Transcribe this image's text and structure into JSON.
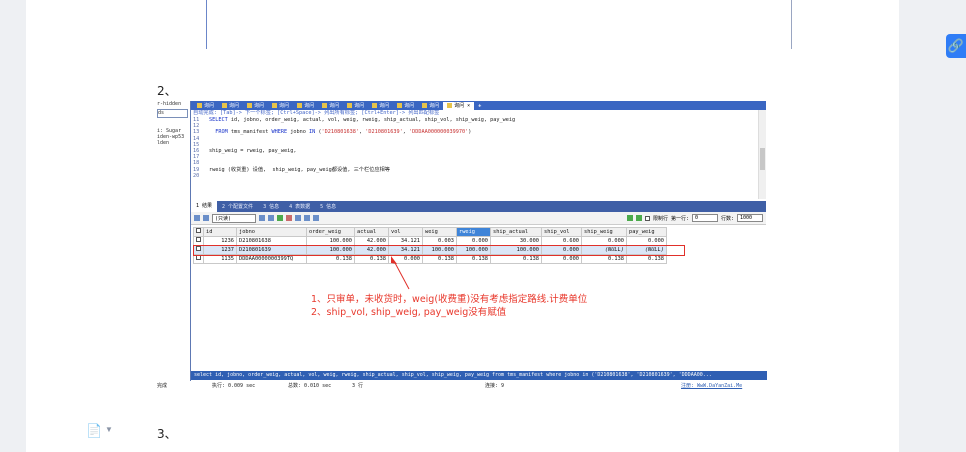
{
  "section2": {
    "heading": "2、"
  },
  "section3": {
    "heading": "3、"
  },
  "left_panel": {
    "items": [
      "r-hidden",
      "ds",
      "i: Sugar",
      "iden-wp53",
      "lden"
    ]
  },
  "query_tabs": [
    {
      "label": "询问"
    },
    {
      "label": "询问"
    },
    {
      "label": "询问"
    },
    {
      "label": "询问"
    },
    {
      "label": "询问"
    },
    {
      "label": "询问"
    },
    {
      "label": "询问"
    },
    {
      "label": "询问"
    },
    {
      "label": "询问"
    },
    {
      "label": "询问"
    },
    {
      "label": "询问",
      "active": true,
      "close": "×"
    }
  ],
  "add_tab": "+",
  "editor": {
    "hint": "自动完成: [Tab]-> 下一个标签; [Ctrl+Space]-> 列出所有标签; [Ctrl+Enter]-> 列出匹配标签",
    "lines": [
      {
        "n": "11",
        "parts": [
          {
            "t": "SELECT",
            "c": "kw"
          },
          {
            "t": " id, jobno, order_weig, actual, vol, weig, rweig, ship_actual, ship_vol, ship_weig, pay_weig"
          }
        ]
      },
      {
        "n": "12",
        "parts": []
      },
      {
        "n": "13",
        "parts": [
          {
            "t": "  FROM",
            "c": "kw"
          },
          {
            "t": " tms_manifest "
          },
          {
            "t": "WHERE",
            "c": "kw"
          },
          {
            "t": " jobno "
          },
          {
            "t": "IN",
            "c": "kw"
          },
          {
            "t": " ("
          },
          {
            "t": "'D210801638'",
            "c": "st"
          },
          {
            "t": ", "
          },
          {
            "t": "'D210801639'",
            "c": "st"
          },
          {
            "t": ", "
          },
          {
            "t": "'DDDAA000000039970'",
            "c": "st"
          },
          {
            "t": ")"
          }
        ]
      },
      {
        "n": "14",
        "parts": []
      },
      {
        "n": "15",
        "parts": []
      },
      {
        "n": "16",
        "parts": [
          {
            "t": "ship_weig = rweig, pay_weig,"
          }
        ]
      },
      {
        "n": "17",
        "parts": []
      },
      {
        "n": "18",
        "parts": []
      },
      {
        "n": "19",
        "parts": [
          {
            "t": "rweig (收货重) 设值,  ship_weig, pay_weig都设值, 三个栏位应相等"
          }
        ]
      },
      {
        "n": "20",
        "parts": []
      }
    ]
  },
  "result_tabs": [
    {
      "label": "1 结果",
      "active": true
    },
    {
      "label": "2 个配置文件"
    },
    {
      "label": "3 信息"
    },
    {
      "label": "4 表数据"
    },
    {
      "label": "5 信息"
    }
  ],
  "toolbar": {
    "readonly_select": "(只读)",
    "limit_label": "限制行",
    "first_row_label": "第一行:",
    "first_row_value": "0",
    "rows_label": "行数:",
    "rows_value": "1000"
  },
  "grid": {
    "columns": [
      "id",
      "jobno",
      "order_weig",
      "actual",
      "vol",
      "weig",
      "rweig",
      "ship_actual",
      "ship_vol",
      "ship_weig",
      "pay_weig"
    ],
    "highlight_column": "rweig",
    "rows": [
      [
        "1236",
        "D210801638",
        "100.000",
        "42.000",
        "34.121",
        "0.003",
        "0.000",
        "30.000",
        "0.600",
        "0.000",
        "0.000"
      ],
      [
        "1237",
        "D210801639",
        "100.000",
        "42.000",
        "34.121",
        "100.000",
        "100.000",
        "100.000",
        "0.000",
        "(NULL)",
        "(NULL)"
      ],
      [
        "1135",
        "DDDAA0000000399TQ",
        "0.138",
        "0.138",
        "0.000",
        "0.138",
        "0.138",
        "0.138",
        "0.000",
        "0.138",
        "0.138"
      ]
    ],
    "selected_row": 1
  },
  "annotation": {
    "line1": "1、只审单，未收货时，weig(收费重)没有考虑指定路线.计费单位",
    "line2": "2、ship_vol, ship_weig, pay_weig没有赋值"
  },
  "status_bar": {
    "sql": "select id, jobno, order_weig, actual, vol, weig, rweig, ship_actual, ship_vol, ship_weig, pay_weig from tms_manifest where jobno in ('D210801638', 'D210801639', 'DDDAA00..."
  },
  "bottom_bar": {
    "left": "完成",
    "exec": "执行: 0.009 sec",
    "total": "总数: 0.010 sec",
    "rows": "3 行",
    "conn": "连接: 9",
    "register": "注册: WwW.DaYanZai.Me"
  },
  "colors": {
    "annotation": "#e8382c",
    "tab_blue": "#3a66c2",
    "share_button": "#2f7df6"
  },
  "icons": [
    "link-icon",
    "document-icon",
    "chevron-down-icon",
    "filter-icon",
    "refresh-icon",
    "save-icon",
    "delete-icon"
  ]
}
